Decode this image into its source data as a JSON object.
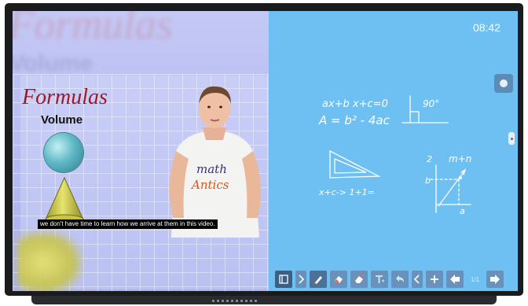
{
  "video": {
    "bg_title": "Formulas",
    "bg_subtitle": "Volume",
    "title": "Formulas",
    "subtitle": "Volume",
    "shirt_line1": "math",
    "shirt_line2": "Antics",
    "caption": "we don't have time to learn how we arrive at them in this video."
  },
  "whiteboard": {
    "clock": "08:42",
    "eq1": "ax+b x+c=0",
    "eq2": "A = b² - 4ac",
    "angle": "90°",
    "eq3": "x+c-> 1+1=",
    "num_2": "2",
    "label_mn": "m+n",
    "label_b": "b",
    "label_a": "a"
  },
  "toolbar": {
    "page": "1/1"
  },
  "colors": {
    "screen_bg": "#6ec0f2",
    "toolbar_btn": "#6892bb",
    "title_red": "#9a1b27"
  },
  "icons": [
    "pages-icon",
    "next-icon",
    "pen-icon",
    "eraser-icon",
    "clear-icon",
    "text-icon",
    "undo-icon",
    "prev-page-icon",
    "add-page-icon",
    "back-arrow-icon",
    "forward-arrow-icon"
  ]
}
